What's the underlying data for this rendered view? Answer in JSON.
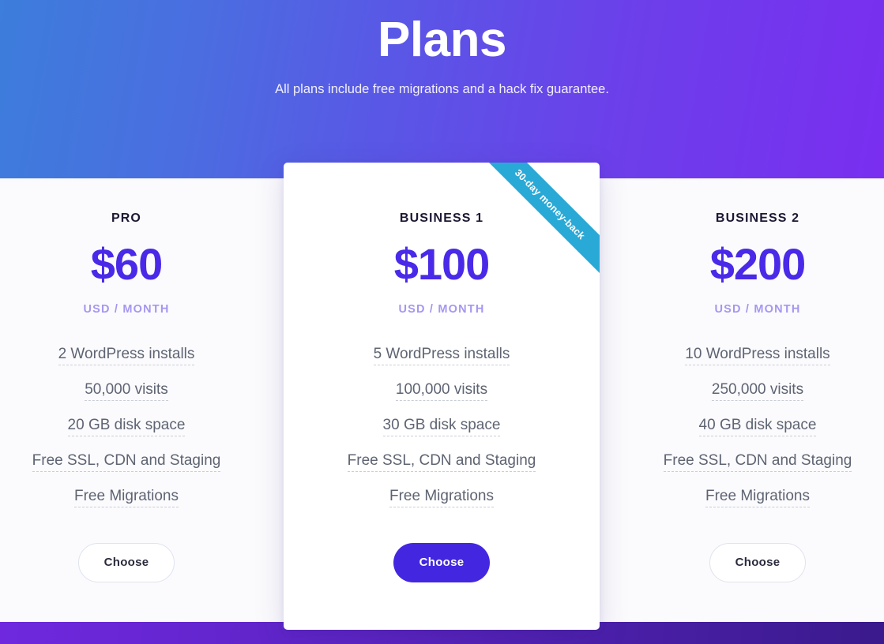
{
  "hero": {
    "title": "Plans",
    "subtitle": "All plans include free migrations and a hack fix guarantee.",
    "gradient_from": "#3d7ddb",
    "gradient_to": "#7a2ef0"
  },
  "footer": {
    "gradient_from": "#6f28de",
    "gradient_to": "#3a1a8c"
  },
  "colors": {
    "price": "#4a2ae8",
    "period": "#a597f0",
    "plan_name": "#1c1833",
    "feature_text": "#5e6472",
    "ribbon": "#29a9d6",
    "button_filled": "#4327e0",
    "button_outline_border": "#dfe3ef"
  },
  "plans": [
    {
      "name": "PRO",
      "price": "$60",
      "period": "USD / MONTH",
      "featured": false,
      "ribbon": null,
      "features": [
        "2 WordPress installs",
        "50,000 visits",
        "20 GB disk space",
        "Free SSL, CDN and Staging",
        "Free Migrations"
      ],
      "cta": "Choose"
    },
    {
      "name": "BUSINESS 1",
      "price": "$100",
      "period": "USD / MONTH",
      "featured": true,
      "ribbon": "30-day money-back",
      "features": [
        "5 WordPress installs",
        "100,000 visits",
        "30 GB disk space",
        "Free SSL, CDN and Staging",
        "Free Migrations"
      ],
      "cta": "Choose"
    },
    {
      "name": "BUSINESS 2",
      "price": "$200",
      "period": "USD / MONTH",
      "featured": false,
      "ribbon": null,
      "features": [
        "10 WordPress installs",
        "250,000 visits",
        "40 GB disk space",
        "Free SSL, CDN and Staging",
        "Free Migrations"
      ],
      "cta": "Choose"
    }
  ]
}
